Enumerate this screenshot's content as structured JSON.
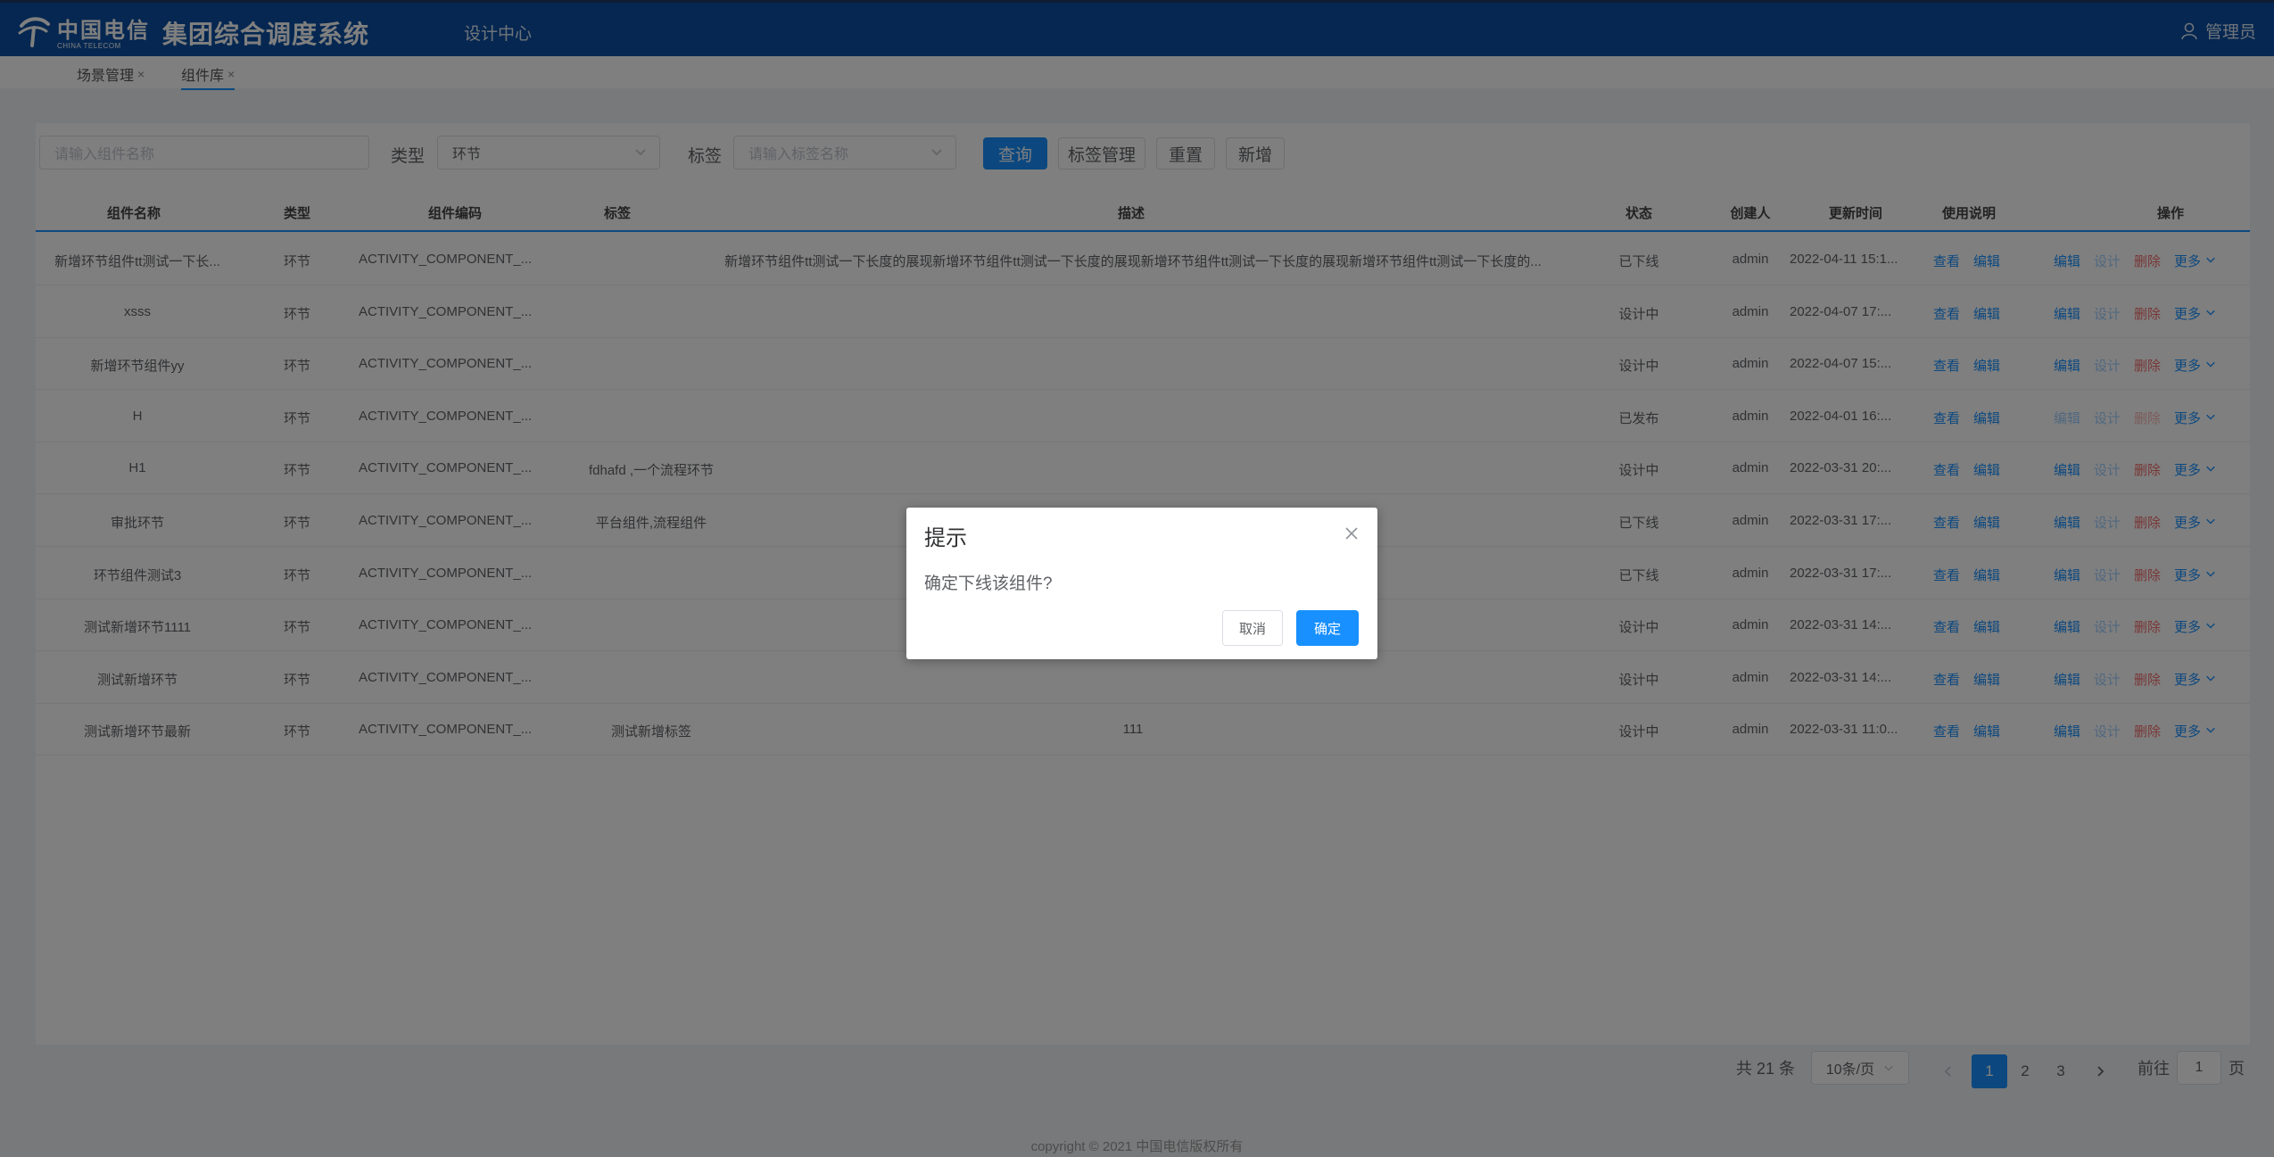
{
  "header": {
    "logo_cn": "中国电信",
    "logo_en": "CHINA TELECOM",
    "system_title": "集团综合调度系统",
    "nav_item": "设计中心",
    "user": "管理员"
  },
  "tabs": [
    {
      "label": "场景管理",
      "close": "×"
    },
    {
      "label": "组件库",
      "close": "×"
    }
  ],
  "filters": {
    "name_placeholder": "请输入组件名称",
    "type_label": "类型",
    "type_value": "环节",
    "tag_label": "标签",
    "tag_placeholder": "请输入标签名称",
    "buttons": {
      "query": "查询",
      "tag_manage": "标签管理",
      "reset": "重置",
      "add": "新增"
    }
  },
  "table": {
    "columns": [
      "组件名称",
      "类型",
      "组件编码",
      "标签",
      "描述",
      "状态",
      "创建人",
      "更新时间",
      "使用说明",
      "操作"
    ],
    "rows": [
      {
        "name": "新增环节组件tt测试一下长...",
        "type": "环节",
        "code": "ACTIVITY_COMPONENT_...",
        "tag": "",
        "desc": "新增环节组件tt测试一下长度的展现新增环节组件tt测试一下长度的展现新增环节组件tt测试一下长度的展现新增环节组件tt测试一下长度的...",
        "status": "已下线",
        "creator": "admin",
        "updated": "2022-04-11 15:1...",
        "ops": [
          "编辑",
          "设计",
          "删除"
        ]
      },
      {
        "name": "xsss",
        "type": "环节",
        "code": "ACTIVITY_COMPONENT_...",
        "tag": "",
        "desc": "",
        "status": "设计中",
        "creator": "admin",
        "updated": "2022-04-07 17:...",
        "ops": [
          "编辑",
          "设计",
          "删除"
        ]
      },
      {
        "name": "新增环节组件yy",
        "type": "环节",
        "code": "ACTIVITY_COMPONENT_...",
        "tag": "",
        "desc": "",
        "status": "设计中",
        "creator": "admin",
        "updated": "2022-04-07 15:...",
        "ops": [
          "编辑",
          "设计",
          "删除"
        ]
      },
      {
        "name": "H",
        "type": "环节",
        "code": "ACTIVITY_COMPONENT_...",
        "tag": "",
        "desc": "",
        "status": "已发布",
        "creator": "admin",
        "updated": "2022-04-01 16:...",
        "ops": [
          "编辑",
          "设计",
          "删除"
        ]
      },
      {
        "name": "H1",
        "type": "环节",
        "code": "ACTIVITY_COMPONENT_...",
        "tag": "fdhafd ,一个流程环节",
        "desc": "",
        "status": "设计中",
        "creator": "admin",
        "updated": "2022-03-31 20:...",
        "ops": [
          "编辑",
          "设计",
          "删除"
        ]
      },
      {
        "name": "审批环节",
        "type": "环节",
        "code": "ACTIVITY_COMPONENT_...",
        "tag": "平台组件,流程组件",
        "desc": "",
        "status": "已下线",
        "creator": "admin",
        "updated": "2022-03-31 17:...",
        "ops": [
          "编辑",
          "设计",
          "删除"
        ]
      },
      {
        "name": "环节组件测试3",
        "type": "环节",
        "code": "ACTIVITY_COMPONENT_...",
        "tag": "",
        "desc": "",
        "status": "已下线",
        "creator": "admin",
        "updated": "2022-03-31 17:...",
        "ops": [
          "编辑",
          "设计",
          "删除"
        ]
      },
      {
        "name": "测试新增环节1111",
        "type": "环节",
        "code": "ACTIVITY_COMPONENT_...",
        "tag": "",
        "desc": "",
        "status": "设计中",
        "creator": "admin",
        "updated": "2022-03-31 14:...",
        "ops": [
          "编辑",
          "设计",
          "删除"
        ]
      },
      {
        "name": "测试新增环节",
        "type": "环节",
        "code": "ACTIVITY_COMPONENT_...",
        "tag": "",
        "desc": "",
        "status": "设计中",
        "creator": "admin",
        "updated": "2022-03-31 14:...",
        "ops": [
          "编辑",
          "设计",
          "删除"
        ]
      },
      {
        "name": "测试新增环节最新",
        "type": "环节",
        "code": "ACTIVITY_COMPONENT_...",
        "tag": "测试新增标签",
        "desc": "111",
        "status": "设计中",
        "creator": "admin",
        "updated": "2022-03-31 11:0...",
        "ops": [
          "编辑",
          "设计",
          "删除"
        ]
      }
    ],
    "usage_links": [
      "查看",
      "编辑"
    ],
    "more_label": "更多"
  },
  "pagination": {
    "total": "共 21 条",
    "page_size": "10条/页",
    "pages": [
      "1",
      "2",
      "3"
    ],
    "current": "1",
    "goto_label": "前往",
    "goto_value": "1",
    "page_suffix": "页"
  },
  "footer": "copyright © 2021 中国电信版权所有",
  "dialog": {
    "title": "提示",
    "message": "确定下线该组件?",
    "cancel": "取消",
    "confirm": "确定"
  }
}
